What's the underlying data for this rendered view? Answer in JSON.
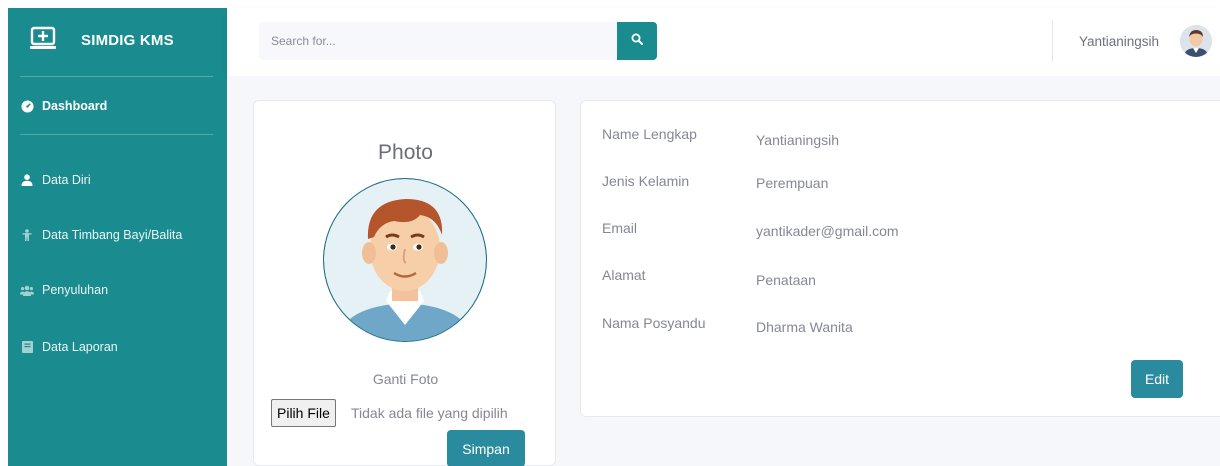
{
  "brand": {
    "name": "SIMDIG KMS",
    "icon": "laptop-plus-icon"
  },
  "sidebar": {
    "items": [
      {
        "label": "Dashboard",
        "icon": "tachometer-icon"
      },
      {
        "label": "Data Diri",
        "icon": "user-icon"
      },
      {
        "label": "Data Timbang Bayi/Balita",
        "icon": "child-icon"
      },
      {
        "label": "Penyuluhan",
        "icon": "users-icon"
      },
      {
        "label": "Data Laporan",
        "icon": "book-icon"
      }
    ]
  },
  "topbar": {
    "search_placeholder": "Search for...",
    "user_name": "Yantianingsih"
  },
  "photo_card": {
    "title": "Photo",
    "change_label": "Ganti Foto",
    "file_button": "Pilih File",
    "file_status": "Tidak ada file yang dipilih",
    "save_label": "Simpan"
  },
  "profile": {
    "fields": [
      {
        "label": "Name Lengkap",
        "value": "Yantianingsih"
      },
      {
        "label": "Jenis Kelamin",
        "value": "Perempuan"
      },
      {
        "label": "Email",
        "value": "yantikader@gmail.com"
      },
      {
        "label": "Alamat",
        "value": "Penataan"
      },
      {
        "label": "Nama Posyandu",
        "value": "Dharma Wanita"
      }
    ],
    "edit_label": "Edit"
  },
  "colors": {
    "primary": "#1a8b8e",
    "button": "#2a8b9e",
    "text_muted": "#858796"
  }
}
